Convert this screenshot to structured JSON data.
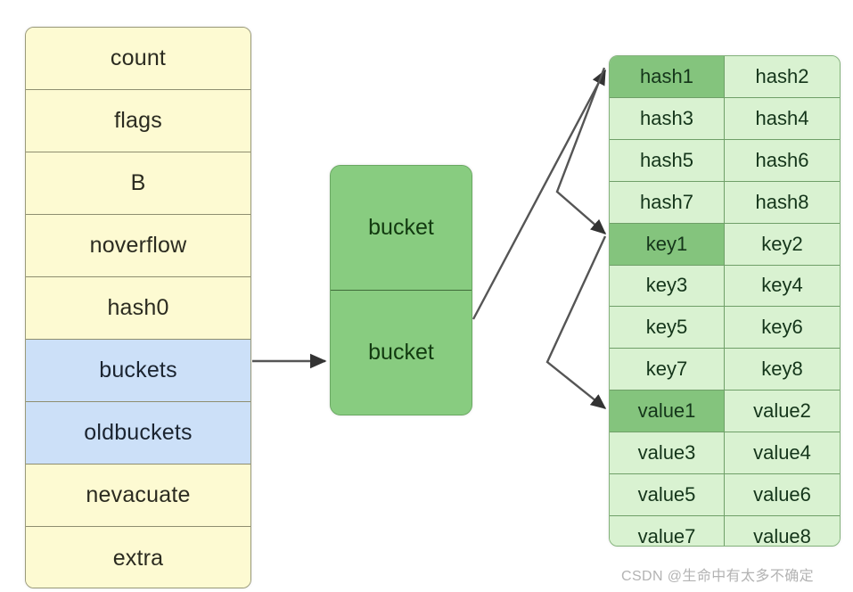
{
  "diagram": {
    "title": "Go map (hmap) memory layout",
    "colors": {
      "struct_fill": "#fdfad2",
      "struct_accent_fill": "#cce0f8",
      "struct_border": "#8e8e70",
      "bucket_fill": "#88cc80",
      "bucket_border": "#3f6b3a",
      "bmap_fill": "#d9f2d1",
      "bmap_highlight_fill": "#84c47d",
      "bmap_border": "#6f9f68",
      "arrow": "#3a3a3a",
      "watermark": "#b3b3b3"
    }
  },
  "hmap_struct": {
    "name": "hmap-struct",
    "fields": [
      {
        "label": "count",
        "highlighted": false
      },
      {
        "label": "flags",
        "highlighted": false
      },
      {
        "label": "B",
        "highlighted": false
      },
      {
        "label": "noverflow",
        "highlighted": false
      },
      {
        "label": "hash0",
        "highlighted": false
      },
      {
        "label": "buckets",
        "highlighted": true
      },
      {
        "label": "oldbuckets",
        "highlighted": true
      },
      {
        "label": "nevacuate",
        "highlighted": false
      },
      {
        "label": "extra",
        "highlighted": false
      }
    ]
  },
  "bucket_array": {
    "name": "bucket-array",
    "cells": [
      {
        "label": "bucket"
      },
      {
        "label": "bucket"
      }
    ]
  },
  "bmap_table": {
    "name": "bmap-table",
    "rows": [
      {
        "left": "hash1",
        "right": "hash2",
        "left_highlighted": true,
        "right_highlighted": false
      },
      {
        "left": "hash3",
        "right": "hash4",
        "left_highlighted": false,
        "right_highlighted": false
      },
      {
        "left": "hash5",
        "right": "hash6",
        "left_highlighted": false,
        "right_highlighted": false
      },
      {
        "left": "hash7",
        "right": "hash8",
        "left_highlighted": false,
        "right_highlighted": false
      },
      {
        "left": "key1",
        "right": "key2",
        "left_highlighted": true,
        "right_highlighted": false
      },
      {
        "left": "key3",
        "right": "key4",
        "left_highlighted": false,
        "right_highlighted": false
      },
      {
        "left": "key5",
        "right": "key6",
        "left_highlighted": false,
        "right_highlighted": false
      },
      {
        "left": "key7",
        "right": "key8",
        "left_highlighted": false,
        "right_highlighted": false
      },
      {
        "left": "value1",
        "right": "value2",
        "left_highlighted": true,
        "right_highlighted": false
      },
      {
        "left": "value3",
        "right": "value4",
        "left_highlighted": false,
        "right_highlighted": false
      },
      {
        "left": "value5",
        "right": "value6",
        "left_highlighted": false,
        "right_highlighted": false
      },
      {
        "left": "value7",
        "right": "value8",
        "left_highlighted": false,
        "right_highlighted": false
      }
    ]
  },
  "connectors": [
    {
      "name": "buckets-to-bucket-array",
      "from": "buckets",
      "to": "bucket"
    },
    {
      "name": "bucket-to-hash1",
      "from": "bucket",
      "to": "hash1"
    },
    {
      "name": "bucket-to-key1",
      "from": "bucket",
      "to": "key1"
    },
    {
      "name": "bucket-to-value1",
      "from": "bucket",
      "to": "value1"
    }
  ],
  "watermark": {
    "text": "CSDN @生命中有太多不确定"
  }
}
